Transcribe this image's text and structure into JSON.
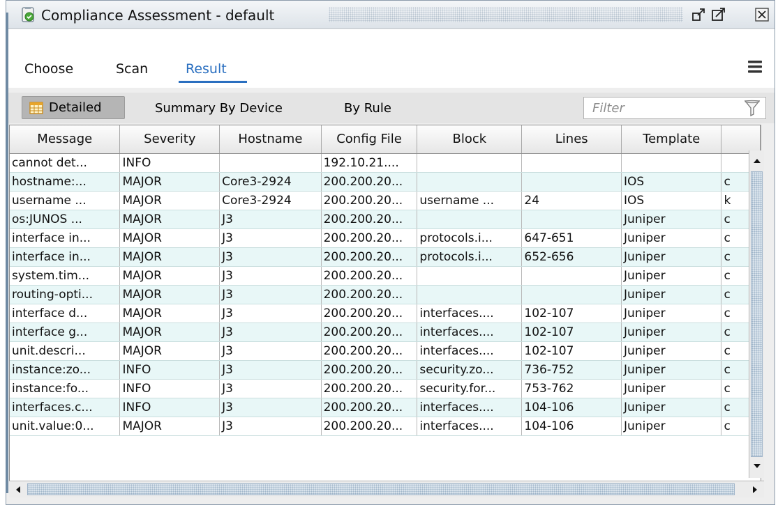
{
  "window": {
    "title": "Compliance Assessment - default"
  },
  "tabs": [
    {
      "label": "Choose"
    },
    {
      "label": "Scan"
    },
    {
      "label": "Result"
    }
  ],
  "views": {
    "detailed": "Detailed",
    "summary_by_device": "Summary By Device",
    "by_rule": "By Rule"
  },
  "filter": {
    "placeholder": "Filter",
    "value": ""
  },
  "table": {
    "columns": [
      "Message",
      "Severity",
      "Hostname",
      "Config File",
      "Block",
      "Lines",
      "Template",
      ""
    ],
    "rows": [
      [
        "cannot det...",
        "INFO",
        "",
        "192.10.21....",
        "",
        "",
        "",
        ""
      ],
      [
        "hostname:...",
        "MAJOR",
        "Core3-2924",
        "200.200.20...",
        "",
        "",
        "IOS",
        "c"
      ],
      [
        "username ...",
        "MAJOR",
        "Core3-2924",
        "200.200.20...",
        "username ...",
        "24",
        "IOS",
        "k"
      ],
      [
        "os:JUNOS ...",
        "MAJOR",
        "J3",
        "200.200.20...",
        "",
        "",
        "Juniper",
        "c"
      ],
      [
        "interface in...",
        "MAJOR",
        "J3",
        "200.200.20...",
        "protocols.i...",
        "647-651",
        "Juniper",
        "c"
      ],
      [
        "interface in...",
        "MAJOR",
        "J3",
        "200.200.20...",
        "protocols.i...",
        "652-656",
        "Juniper",
        "c"
      ],
      [
        "system.tim...",
        "MAJOR",
        "J3",
        "200.200.20...",
        "",
        "",
        "Juniper",
        "c"
      ],
      [
        "routing-opti...",
        "MAJOR",
        "J3",
        "200.200.20...",
        "",
        "",
        "Juniper",
        "c"
      ],
      [
        "interface d...",
        "MAJOR",
        "J3",
        "200.200.20...",
        "interfaces....",
        "102-107",
        "Juniper",
        "c"
      ],
      [
        "interface g...",
        "MAJOR",
        "J3",
        "200.200.20...",
        "interfaces....",
        "102-107",
        "Juniper",
        "c"
      ],
      [
        "unit.descri...",
        "MAJOR",
        "J3",
        "200.200.20...",
        "interfaces....",
        "102-107",
        "Juniper",
        "c"
      ],
      [
        "instance:zo...",
        "INFO",
        "J3",
        "200.200.20...",
        "security.zo...",
        "736-752",
        "Juniper",
        "c"
      ],
      [
        "instance:fo...",
        "INFO",
        "J3",
        "200.200.20...",
        "security.for...",
        "753-762",
        "Juniper",
        "c"
      ],
      [
        "interfaces.c...",
        "INFO",
        "J3",
        "200.200.20...",
        "interfaces....",
        "104-106",
        "Juniper",
        "c"
      ],
      [
        "unit.value:0...",
        "MAJOR",
        "J3",
        "200.200.20...",
        "interfaces....",
        "104-106",
        "Juniper",
        "c"
      ]
    ]
  },
  "icons": {
    "title": "compliance-assessment-icon",
    "float": "float-window-icon",
    "maximize": "maximize-icon",
    "close": "close-icon",
    "menu": "hamburger-menu-icon",
    "grid": "table-grid-icon",
    "filter": "funnel-icon"
  },
  "colors": {
    "accent": "#2a6fc0",
    "row_alt": "#e8f7f7",
    "toolbar": "#e4e4e4",
    "selected_view": "#b5b5b5"
  }
}
